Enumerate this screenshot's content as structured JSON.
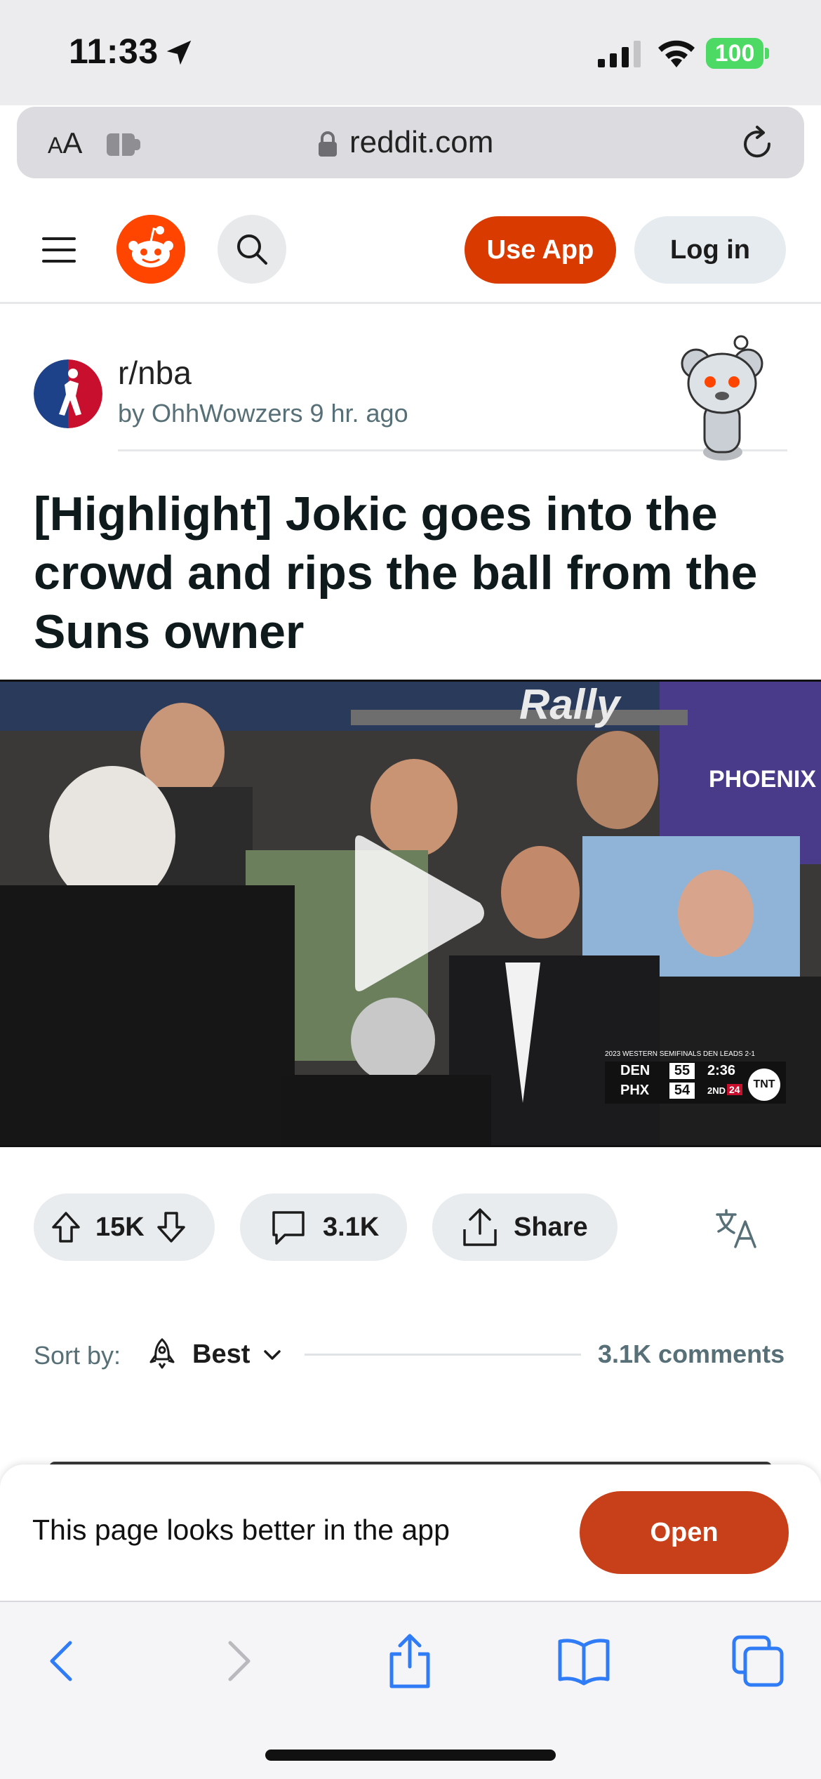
{
  "status_bar": {
    "time": "11:33",
    "battery": "100",
    "icons": [
      "location-arrow-icon",
      "signal-icon",
      "wifi-icon",
      "battery-icon"
    ]
  },
  "browser": {
    "text_size_label": "AA",
    "url": "reddit.com",
    "icons": [
      "extension-icon",
      "lock-icon",
      "reload-icon"
    ]
  },
  "header": {
    "use_app_label": "Use App",
    "login_label": "Log in",
    "icons": [
      "menu-icon",
      "reddit-logo-icon",
      "search-icon"
    ],
    "accent_color": "#d93a00"
  },
  "post": {
    "subreddit": "r/nba",
    "by_prefix": "by",
    "author": "OhhWowzers",
    "age": "9 hr. ago",
    "title": "[Highlight] Jokic goes into the crowd and rips the ball from the Suns owner",
    "video": {
      "scorebug": {
        "banner": "2023 WESTERN SEMIFINALS  DEN LEADS 2-1",
        "team1": "DEN",
        "score1": "55",
        "team2": "PHX",
        "score2": "54",
        "clock": "2:36",
        "quarter": "2ND",
        "shot_clock": "24",
        "network": "TNT"
      },
      "jersey_text": "PHOENIX",
      "sign_text": "Rally"
    }
  },
  "actions": {
    "votes": "15K",
    "comments": "3.1K",
    "share_label": "Share"
  },
  "sort": {
    "label": "Sort by:",
    "value": "Best",
    "comments_count": "3.1K comments"
  },
  "app_banner": {
    "text": "This page looks better in the app",
    "open_label": "Open",
    "button_color": "#c8401a"
  },
  "toolbar": {
    "icons": [
      "back-icon",
      "forward-icon",
      "share-icon",
      "bookmarks-icon",
      "tabs-icon"
    ]
  }
}
